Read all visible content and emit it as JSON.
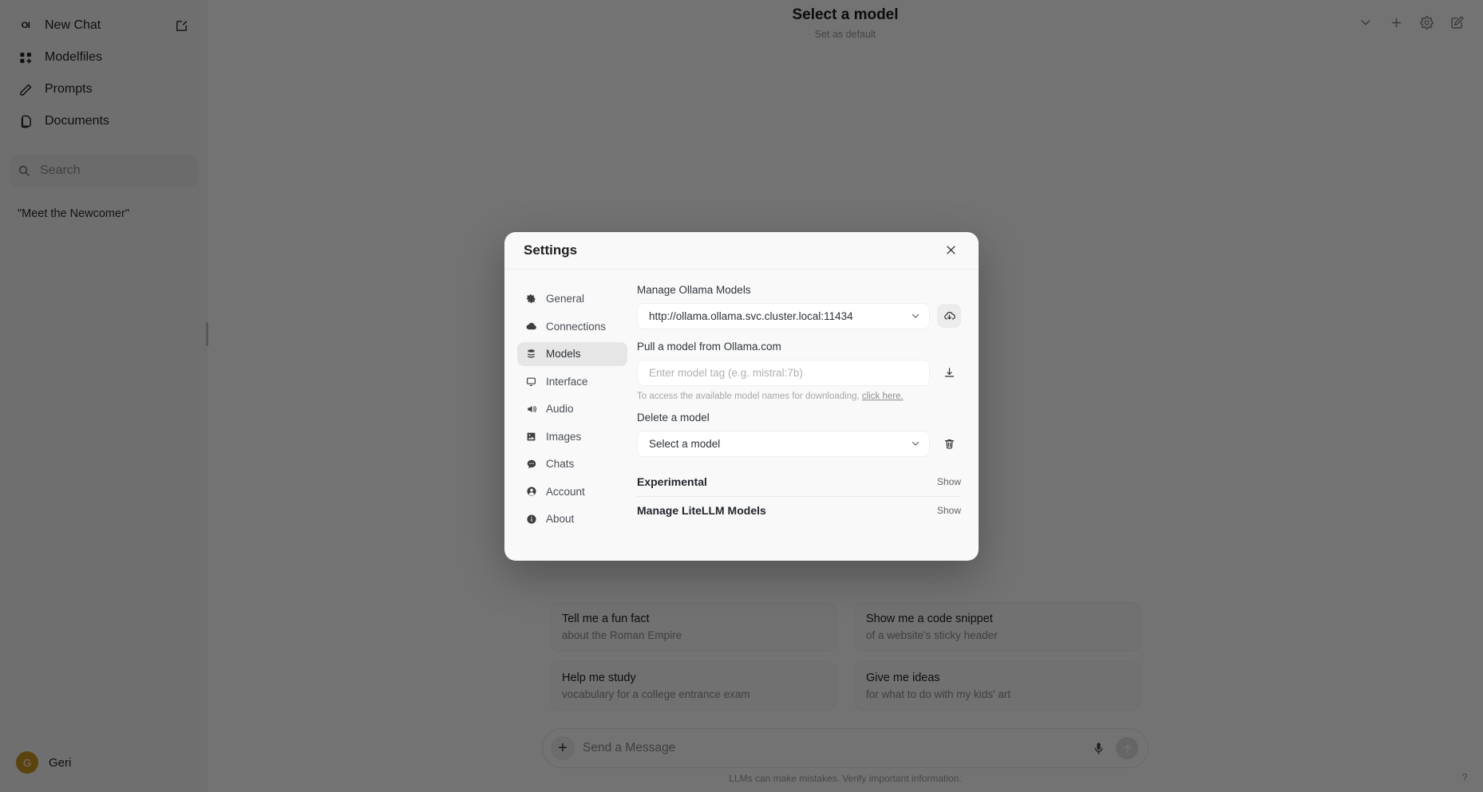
{
  "sidebar": {
    "logo_text": "OI",
    "new_chat_label": "New Chat",
    "items": [
      {
        "label": "Modelfiles",
        "icon": "modelfiles-icon"
      },
      {
        "label": "Prompts",
        "icon": "pencil-icon"
      },
      {
        "label": "Documents",
        "icon": "documents-icon"
      }
    ],
    "search_placeholder": "Search",
    "chat_history": [
      {
        "title": "\"Meet the Newcomer\""
      }
    ],
    "user": {
      "initial": "G",
      "name": "Geri"
    }
  },
  "topbar": {
    "model_title": "Select a model",
    "set_default_label": "Set as default",
    "chevron_icon": "chevron-down-icon",
    "new_chat_icon": "plus-icon",
    "settings_icon": "gear-icon",
    "edit_icon": "edit-square-icon"
  },
  "suggestions": [
    {
      "title": "Tell me a fun fact",
      "subtitle": "about the Roman Empire"
    },
    {
      "title": "Show me a code snippet",
      "subtitle": "of a website's sticky header"
    },
    {
      "title": "Help me study",
      "subtitle": "vocabulary for a college entrance exam"
    },
    {
      "title": "Give me ideas",
      "subtitle": "for what to do with my kids' art"
    }
  ],
  "composer": {
    "placeholder": "Send a Message",
    "plus_icon": "plus-icon",
    "mic_icon": "microphone-icon",
    "send_icon": "arrow-up-icon"
  },
  "footer": {
    "disclaimer": "LLMs can make mistakes. Verify important information.",
    "help_label": "?"
  },
  "modal": {
    "title": "Settings",
    "close_icon": "close-icon",
    "nav": [
      {
        "label": "General",
        "icon": "gear-icon",
        "active": false
      },
      {
        "label": "Connections",
        "icon": "cloud-icon",
        "active": false
      },
      {
        "label": "Models",
        "icon": "database-icon",
        "active": true
      },
      {
        "label": "Interface",
        "icon": "monitor-icon",
        "active": false
      },
      {
        "label": "Audio",
        "icon": "speaker-icon",
        "active": false
      },
      {
        "label": "Images",
        "icon": "image-icon",
        "active": false
      },
      {
        "label": "Chats",
        "icon": "chat-bubble-icon",
        "active": false
      },
      {
        "label": "Account",
        "icon": "user-circle-icon",
        "active": false
      },
      {
        "label": "About",
        "icon": "info-icon",
        "active": false
      }
    ],
    "models_panel": {
      "manage_ollama_label": "Manage Ollama Models",
      "ollama_url_value": "http://ollama.ollama.svc.cluster.local:11434",
      "ollama_url_chevron": "chevron-down-icon",
      "ollama_refresh_icon": "download-cloud-icon",
      "pull_model_label": "Pull a model from Ollama.com",
      "pull_model_placeholder": "Enter model tag (e.g. mistral:7b)",
      "pull_button_icon": "download-icon",
      "hint_prefix": "To access the available model names for downloading, ",
      "hint_link": "click here.",
      "delete_model_label": "Delete a model",
      "delete_model_value": "Select a model",
      "delete_model_chevron": "chevron-down-icon",
      "delete_button_icon": "trash-icon",
      "experimental_label": "Experimental",
      "experimental_action": "Show",
      "litellm_label": "Manage LiteLLM Models",
      "litellm_action": "Show"
    }
  },
  "colors": {
    "accent": "#c9951f",
    "modal_bg": "#f9f9f9",
    "active_nav": "#e6e6e6"
  }
}
